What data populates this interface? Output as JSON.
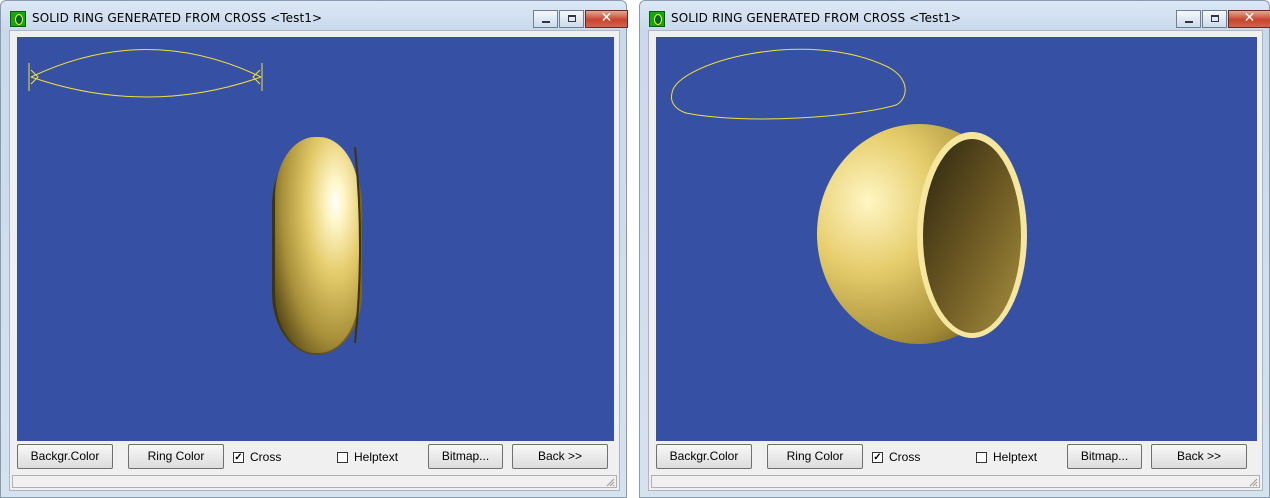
{
  "windows": [
    {
      "title": "SOLID RING GENERATED FROM CROSS <Test1>",
      "view": "side",
      "background_color": "#3651a4",
      "ring_color": "#e8d27a",
      "cross_color": "#f3e03a",
      "toolbar": {
        "background_color_button": "Backgr.Color",
        "ring_color_button": "Ring Color",
        "cross_checkbox": {
          "label": "Cross",
          "checked": true
        },
        "helptext_checkbox": {
          "label": "Helptext",
          "checked": false
        },
        "bitmap_button": "Bitmap...",
        "back_button": "Back >>"
      }
    },
    {
      "title": "SOLID RING GENERATED FROM CROSS <Test1>",
      "view": "perspective",
      "background_color": "#3651a4",
      "ring_color": "#e8d27a",
      "cross_color": "#f3e03a",
      "toolbar": {
        "background_color_button": "Backgr.Color",
        "ring_color_button": "Ring Color",
        "cross_checkbox": {
          "label": "Cross",
          "checked": true
        },
        "helptext_checkbox": {
          "label": "Helptext",
          "checked": false
        },
        "bitmap_button": "Bitmap...",
        "back_button": "Back >>"
      }
    }
  ]
}
